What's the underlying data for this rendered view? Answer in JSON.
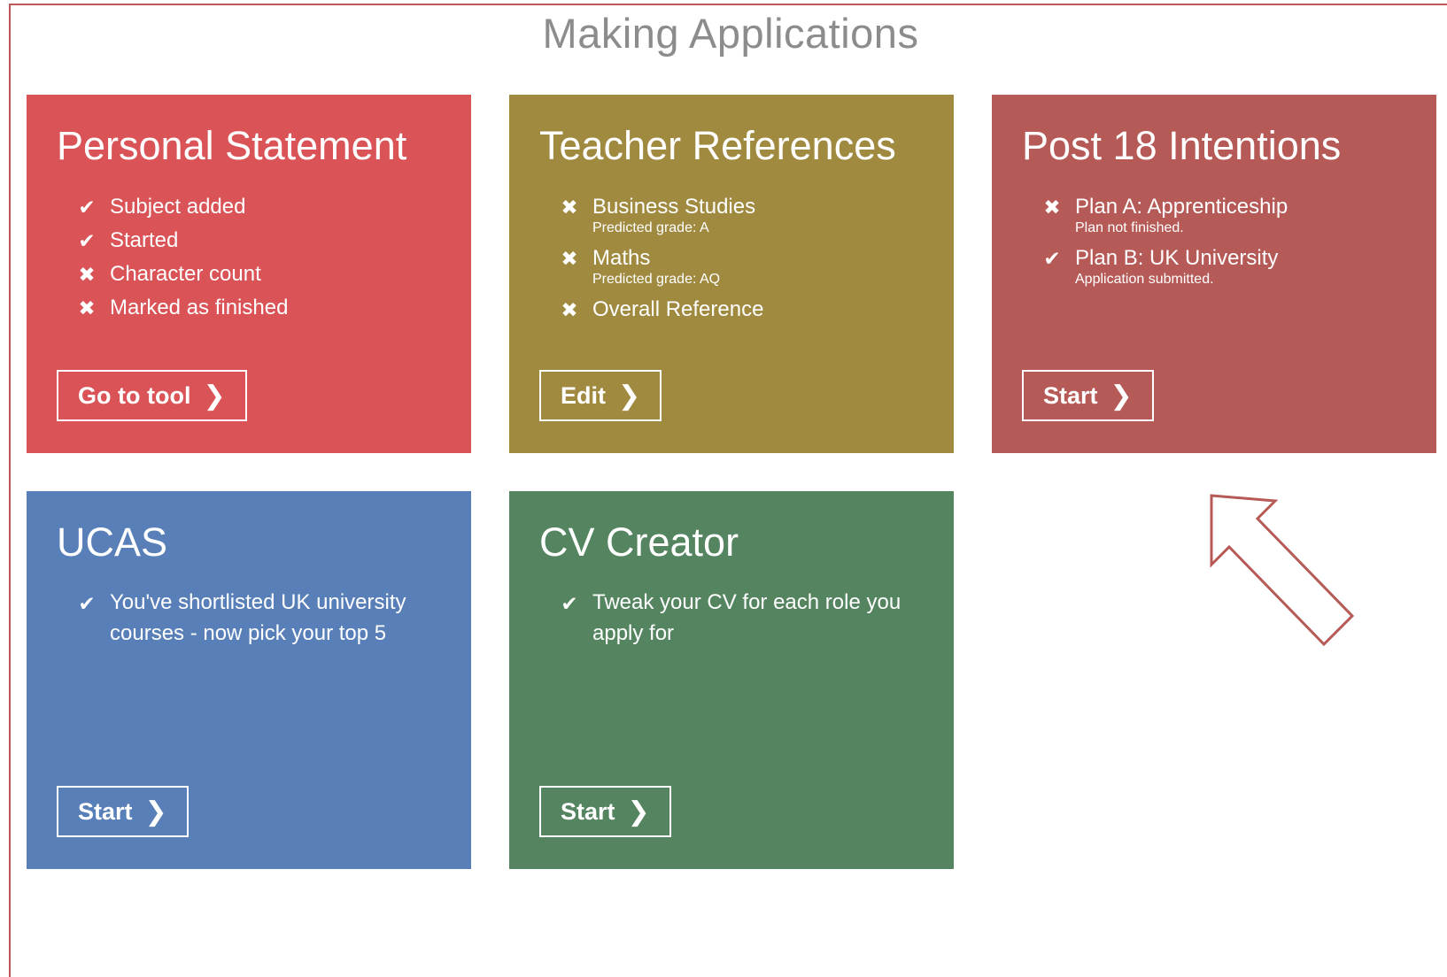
{
  "page": {
    "title": "Making Applications"
  },
  "icons": {
    "check": "check-icon",
    "cross": "cross-icon",
    "chevron": "chevron-right-icon"
  },
  "colors": {
    "personal_statement": "#d95357",
    "teacher_references": "#a08a40",
    "post18": "#b55a57",
    "ucas": "#587fb7",
    "cv": "#558460",
    "arrow": "#b55a57"
  },
  "cards": {
    "personal_statement": {
      "title": "Personal Statement",
      "items": [
        {
          "status": "done",
          "symbol": "✔",
          "text": "Subject added"
        },
        {
          "status": "done",
          "symbol": "✔",
          "text": "Started"
        },
        {
          "status": "todo",
          "symbol": "✖",
          "text": "Character count"
        },
        {
          "status": "todo",
          "symbol": "✖",
          "text": "Marked as finished"
        }
      ],
      "button": {
        "label": "Go to tool",
        "chevron": "❯"
      }
    },
    "teacher_references": {
      "title": "Teacher References",
      "items": [
        {
          "status": "todo",
          "symbol": "✖",
          "text": "Business Studies",
          "sub": "Predicted grade: A"
        },
        {
          "status": "todo",
          "symbol": "✖",
          "text": "Maths",
          "sub": "Predicted grade: AQ"
        },
        {
          "status": "todo",
          "symbol": "✖",
          "text": "Overall Reference"
        }
      ],
      "button": {
        "label": "Edit",
        "chevron": "❯"
      }
    },
    "post18": {
      "title": "Post 18 Intentions",
      "items": [
        {
          "status": "todo",
          "symbol": "✖",
          "text": "Plan A: Apprenticeship",
          "sub": "Plan not finished."
        },
        {
          "status": "done",
          "symbol": "✔",
          "text": "Plan B: UK University",
          "sub": "Application submitted."
        }
      ],
      "button": {
        "label": "Start",
        "chevron": "❯"
      }
    },
    "ucas": {
      "title": "UCAS",
      "items": [
        {
          "status": "done",
          "symbol": "✔",
          "text": "You've shortlisted UK university courses - now pick your top 5"
        }
      ],
      "button": {
        "label": "Start",
        "chevron": "❯"
      }
    },
    "cv": {
      "title": "CV Creator",
      "items": [
        {
          "status": "done",
          "symbol": "✔",
          "text": "Tweak your CV for each role you apply for"
        }
      ],
      "button": {
        "label": "Start",
        "chevron": "❯"
      }
    }
  }
}
